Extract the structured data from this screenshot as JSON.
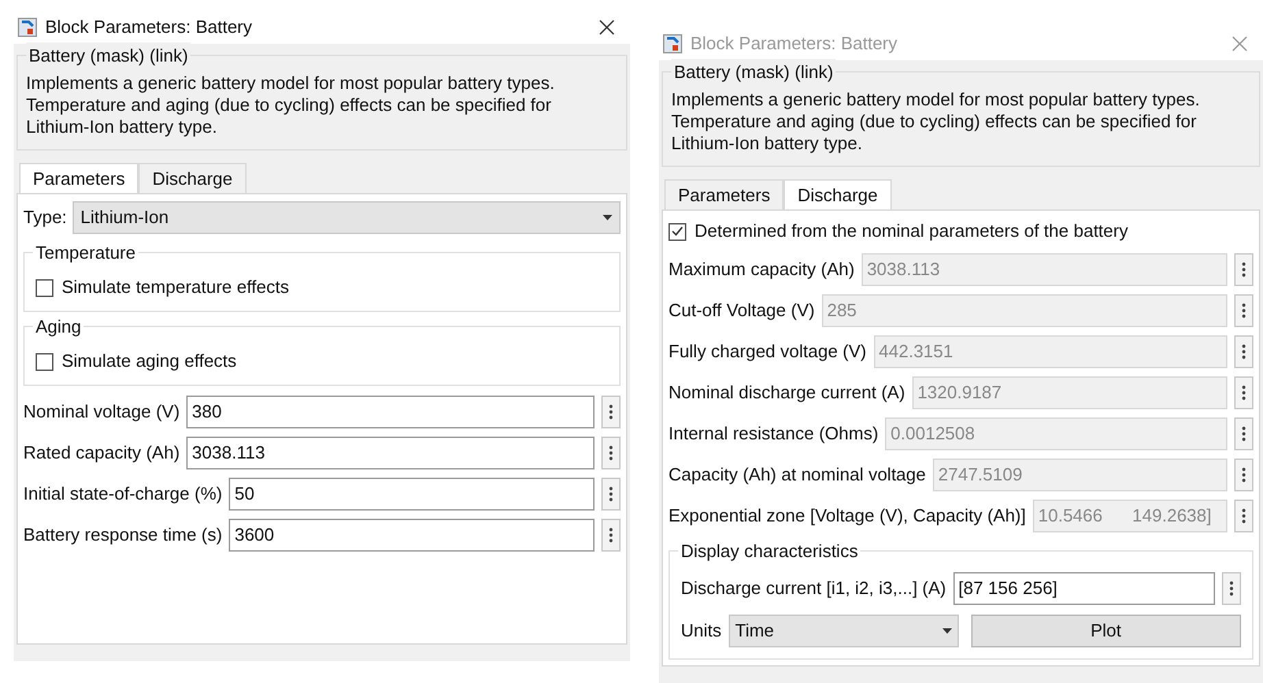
{
  "dialogs": [
    {
      "title": "Block Parameters: Battery",
      "active": true,
      "group_title": "Battery (mask) (link)",
      "description": "Implements a generic battery model for most popular battery types. Temperature and aging (due to cycling) effects can be specified for Lithium-Ion battery type.",
      "tabs": [
        {
          "label": "Parameters",
          "selected": true
        },
        {
          "label": "Discharge",
          "selected": false
        }
      ],
      "items": [
        {
          "kind": "dropdown",
          "label": "Type:",
          "value": "Lithium-Ion"
        },
        {
          "kind": "group",
          "title": "Temperature",
          "items": [
            {
              "kind": "checkbox",
              "label": "Simulate temperature effects",
              "checked": false
            }
          ]
        },
        {
          "kind": "group",
          "title": "Aging",
          "items": [
            {
              "kind": "checkbox",
              "label": "Simulate aging effects",
              "checked": false
            }
          ]
        },
        {
          "kind": "field",
          "label": "Nominal voltage (V)",
          "value": "380",
          "disabled": false
        },
        {
          "kind": "field",
          "label": "Rated capacity (Ah)",
          "value": "3038.113",
          "disabled": false
        },
        {
          "kind": "field",
          "label": "Initial state-of-charge (%)",
          "value": "50",
          "disabled": false
        },
        {
          "kind": "field",
          "label": "Battery response time (s)",
          "value": "3600",
          "disabled": false
        }
      ]
    },
    {
      "title": "Block Parameters: Battery",
      "active": false,
      "group_title": "Battery (mask) (link)",
      "description": "Implements a generic battery model for most popular battery types. Temperature and aging (due to cycling) effects can be specified for Lithium-Ion battery type.",
      "tabs": [
        {
          "label": "Parameters",
          "selected": false
        },
        {
          "label": "Discharge",
          "selected": true
        }
      ],
      "items": [
        {
          "kind": "checkbox",
          "label": "Determined from the nominal parameters of the battery",
          "checked": true
        },
        {
          "kind": "field",
          "label": "Maximum capacity (Ah)",
          "value": "3038.113",
          "disabled": true
        },
        {
          "kind": "field",
          "label": "Cut-off Voltage (V)",
          "value": "285",
          "disabled": true
        },
        {
          "kind": "field",
          "label": "Fully charged voltage (V)",
          "value": "442.3151",
          "disabled": true
        },
        {
          "kind": "field",
          "label": "Nominal discharge current (A)",
          "value": "1320.9187",
          "disabled": true
        },
        {
          "kind": "field",
          "label": "Internal resistance (Ohms)",
          "value": "0.0012508",
          "disabled": true
        },
        {
          "kind": "field",
          "label": "Capacity (Ah) at nominal voltage",
          "value": "2747.5109",
          "disabled": true
        },
        {
          "kind": "field",
          "label": "Exponential zone [Voltage (V), Capacity (Ah)]",
          "value": "10.5466      149.2638]",
          "disabled": true
        },
        {
          "kind": "group",
          "title": "Display characteristics",
          "items": [
            {
              "kind": "field",
              "label": "Discharge current [i1, i2, i3,...] (A)",
              "value": "[87 156 256]",
              "disabled": false
            },
            {
              "kind": "units",
              "label": "Units",
              "value": "Time",
              "button": "Plot"
            }
          ]
        }
      ]
    }
  ]
}
